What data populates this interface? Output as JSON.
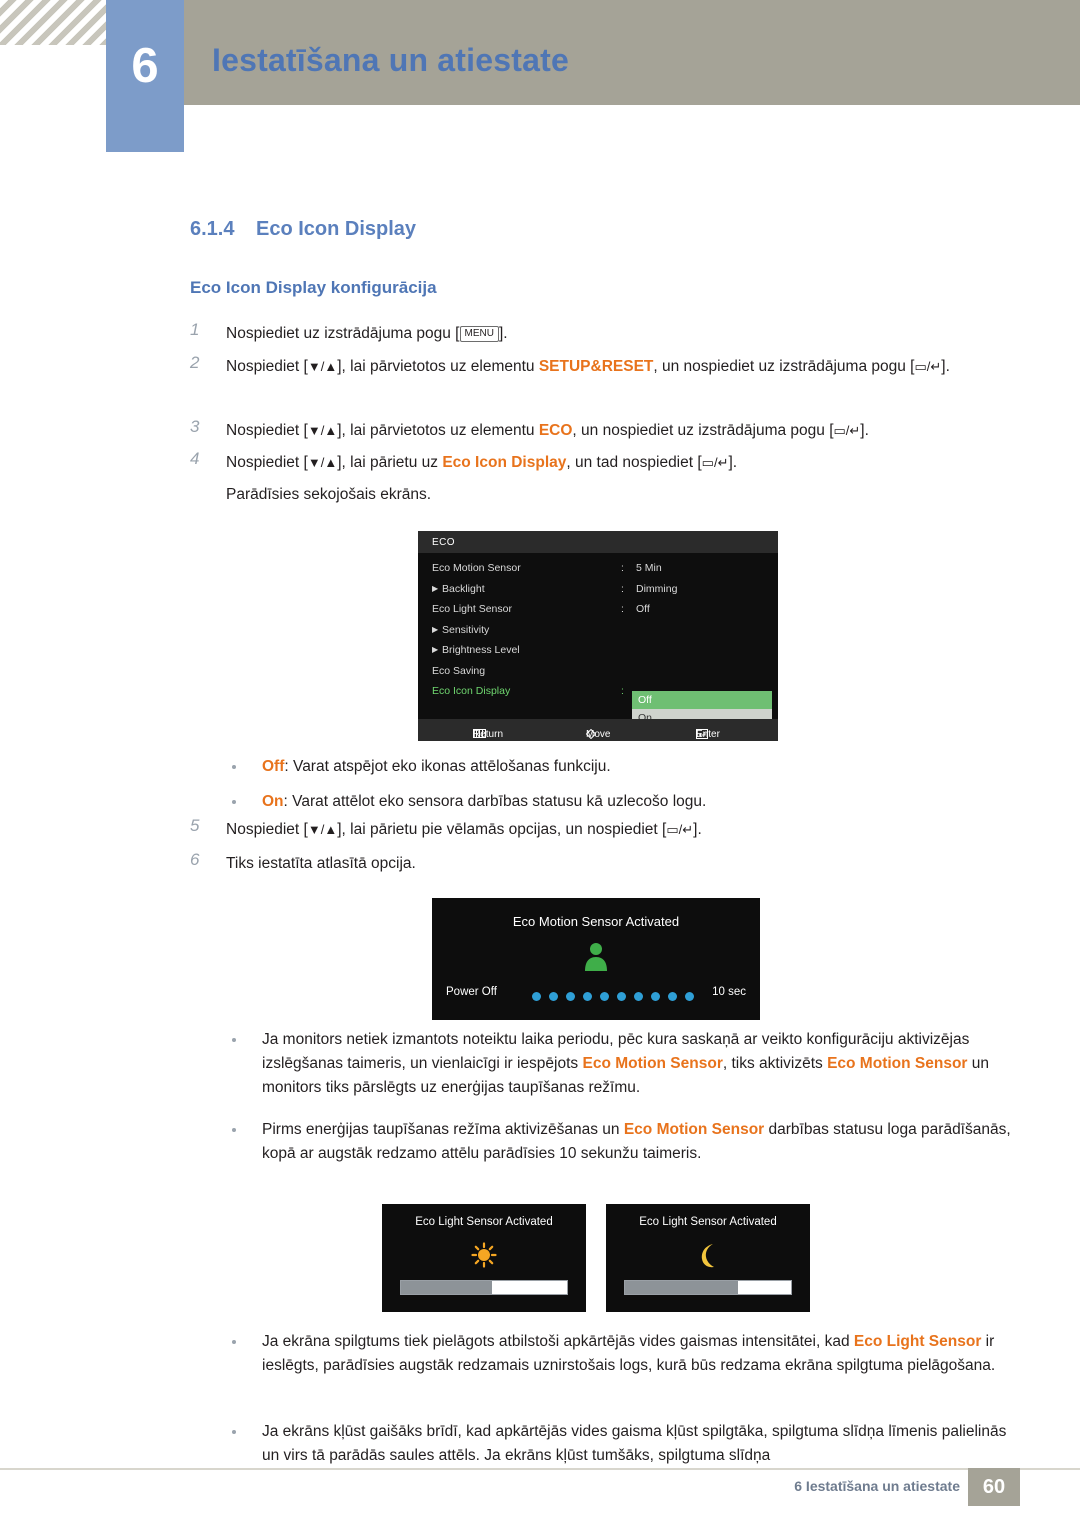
{
  "header": {
    "chapter_number": "6",
    "title": "Iestatīšana un atiestate"
  },
  "section": {
    "number": "6.1.4",
    "title": "Eco Icon Display",
    "subheading": "Eco Icon Display konfigurācija"
  },
  "steps": [
    {
      "n": "1",
      "parts": [
        {
          "t": "Nospiediet uz izstrādājuma pogu ["
        },
        {
          "t": "MENU",
          "style": "key"
        },
        {
          "t": "]."
        }
      ]
    },
    {
      "n": "2",
      "parts": [
        {
          "t": "Nospiediet ["
        },
        {
          "t": "▼/▲",
          "style": "glyph"
        },
        {
          "t": "], lai pārvietotos uz elementu "
        },
        {
          "t": "SETUP&RESET",
          "style": "orange"
        },
        {
          "t": ", un nospiediet uz izstrādājuma pogu ["
        },
        {
          "t": "▭/↵",
          "style": "glyph"
        },
        {
          "t": "]."
        }
      ]
    },
    {
      "n": "3",
      "parts": [
        {
          "t": "Nospiediet ["
        },
        {
          "t": "▼/▲",
          "style": "glyph"
        },
        {
          "t": "], lai pārvietotos uz elementu "
        },
        {
          "t": "ECO",
          "style": "orange"
        },
        {
          "t": ", un nospiediet uz izstrādājuma pogu ["
        },
        {
          "t": "▭/↵",
          "style": "glyph"
        },
        {
          "t": "]."
        }
      ]
    },
    {
      "n": "4",
      "parts": [
        {
          "t": "Nospiediet ["
        },
        {
          "t": "▼/▲",
          "style": "glyph"
        },
        {
          "t": "], lai pārietu uz "
        },
        {
          "t": "Eco Icon Display",
          "style": "orange"
        },
        {
          "t": ", un tad nospiediet ["
        },
        {
          "t": "▭/↵",
          "style": "glyph"
        },
        {
          "t": "]."
        }
      ],
      "note": "Parādīsies sekojošais ekrāns."
    },
    {
      "n": "5",
      "parts": [
        {
          "t": "Nospiediet ["
        },
        {
          "t": "▼/▲",
          "style": "glyph"
        },
        {
          "t": "], lai pārietu pie vēlamās opcijas, un nospiediet ["
        },
        {
          "t": "▭/↵",
          "style": "glyph"
        },
        {
          "t": "]."
        }
      ]
    },
    {
      "n": "6",
      "parts": [
        {
          "t": "Tiks iestatīta atlasītā opcija."
        }
      ]
    }
  ],
  "osd_menu": {
    "title": "ECO",
    "rows": [
      {
        "label": "Eco Motion Sensor",
        "indent": false,
        "colon": ":",
        "value": "5 Min",
        "selected": false
      },
      {
        "label": "Backlight",
        "indent": true,
        "colon": ":",
        "value": "Dimming",
        "selected": false
      },
      {
        "label": "Eco Light Sensor",
        "indent": false,
        "colon": ":",
        "value": "Off",
        "selected": false
      },
      {
        "label": "Sensitivity",
        "indent": true,
        "colon": "",
        "value": "",
        "selected": false
      },
      {
        "label": "Brightness Level",
        "indent": true,
        "colon": "",
        "value": "",
        "selected": false
      },
      {
        "label": "Eco Saving",
        "indent": false,
        "colon": "",
        "value": "",
        "selected": false
      },
      {
        "label": "Eco Icon Display",
        "indent": false,
        "colon": ":",
        "value": "",
        "selected": true
      }
    ],
    "options": [
      {
        "label": "Off",
        "highlighted": true
      },
      {
        "label": "On",
        "highlighted": false
      }
    ],
    "footer": {
      "return": "Return",
      "move": "Move",
      "enter": "Enter"
    }
  },
  "option_bullets": [
    {
      "parts": [
        {
          "t": "Off",
          "style": "orange"
        },
        {
          "t": ": Varat atspējot eko ikonas attēlošanas funkciju."
        }
      ]
    },
    {
      "parts": [
        {
          "t": "On",
          "style": "orange"
        },
        {
          "t": ": Varat attēlot eko sensora darbības statusu kā uzlecošo logu."
        }
      ]
    }
  ],
  "osd_motion": {
    "title": "Eco Motion Sensor Activated",
    "power_off_label": "Power Off",
    "dot_count": 10,
    "seconds_label": "10 sec"
  },
  "notes": [
    {
      "parts": [
        {
          "t": "Ja monitors netiek izmantots noteiktu laika periodu, pēc kura saskaņā ar veikto konfigurāciju aktivizējas izslēgšanas taimeris, un vienlaicīgi ir iespējots "
        },
        {
          "t": "Eco Motion Sensor",
          "style": "orange"
        },
        {
          "t": ", tiks aktivizēts "
        },
        {
          "t": "Eco Motion Sensor",
          "style": "orange"
        },
        {
          "t": " un monitors tiks pārslēgts uz enerģijas taupīšanas režīmu."
        }
      ]
    },
    {
      "parts": [
        {
          "t": "Pirms enerģijas taupīšanas režīma aktivizēšanas un "
        },
        {
          "t": "Eco Motion Sensor",
          "style": "orange"
        },
        {
          "t": " darbības statusu loga parādīšanās, kopā ar augstāk redzamo attēlu parādīsies 10 sekunžu taimeris."
        }
      ]
    }
  ],
  "osd_light": [
    {
      "title": "Eco Light Sensor Activated",
      "icon": "sun-icon",
      "fill_percent": 55
    },
    {
      "title": "Eco Light Sensor Activated",
      "icon": "moon-icon",
      "fill_percent": 68
    }
  ],
  "notes2": [
    {
      "parts": [
        {
          "t": "Ja ekrāna spilgtums tiek pielāgots atbilstoši apkārtējās vides gaismas intensitātei, kad "
        },
        {
          "t": "Eco Light Sensor",
          "style": "orange"
        },
        {
          "t": " ir ieslēgts, parādīsies augstāk redzamais uznirstošais logs, kurā būs redzama ekrāna spilgtuma pielāgošana."
        }
      ]
    },
    {
      "parts": [
        {
          "t": "Ja ekrāns kļūst gaišāks brīdī, kad apkārtējās vides gaisma kļūst spilgtāka, spilgtuma slīdņa līmenis palielinās un virs tā parādās saules attēls. Ja ekrāns kļūst tumšāks, spilgtuma slīdņa"
        }
      ]
    }
  ],
  "footer": {
    "text": "6 Iestatīšana un atiestate",
    "page": "60"
  },
  "colors": {
    "accent_blue": "#4f76b5",
    "orange": "#e8731c",
    "header_bar": "#a5a397",
    "number_box": "#7d9cc9",
    "osd_green": "#6fbf73"
  }
}
